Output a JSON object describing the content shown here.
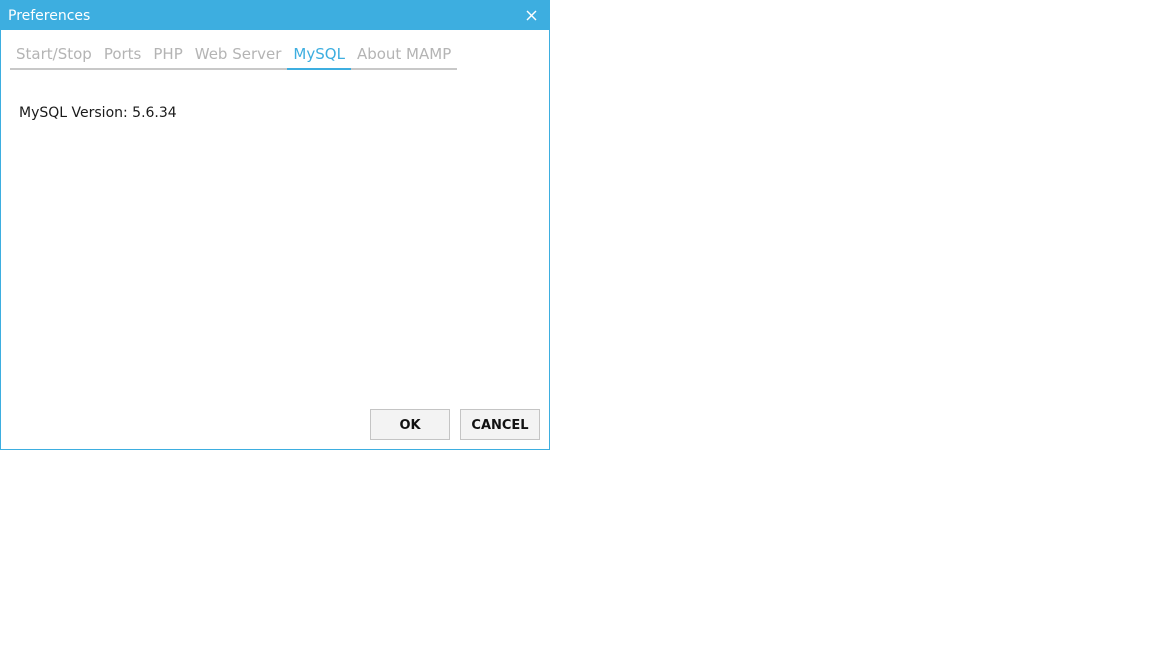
{
  "window": {
    "title": "Preferences"
  },
  "tabs": [
    {
      "label": "Start/Stop",
      "active": false
    },
    {
      "label": "Ports",
      "active": false
    },
    {
      "label": "PHP",
      "active": false
    },
    {
      "label": "Web Server",
      "active": false
    },
    {
      "label": "MySQL",
      "active": true
    },
    {
      "label": "About MAMP",
      "active": false
    }
  ],
  "mysql": {
    "version_text": "MySQL Version: 5.6.34"
  },
  "buttons": {
    "ok_label": "OK",
    "cancel_label": "CANCEL"
  },
  "colors": {
    "accent": "#3daee0",
    "tab_inactive": "#b4b4b4"
  },
  "icons": {
    "close": "close-icon"
  }
}
